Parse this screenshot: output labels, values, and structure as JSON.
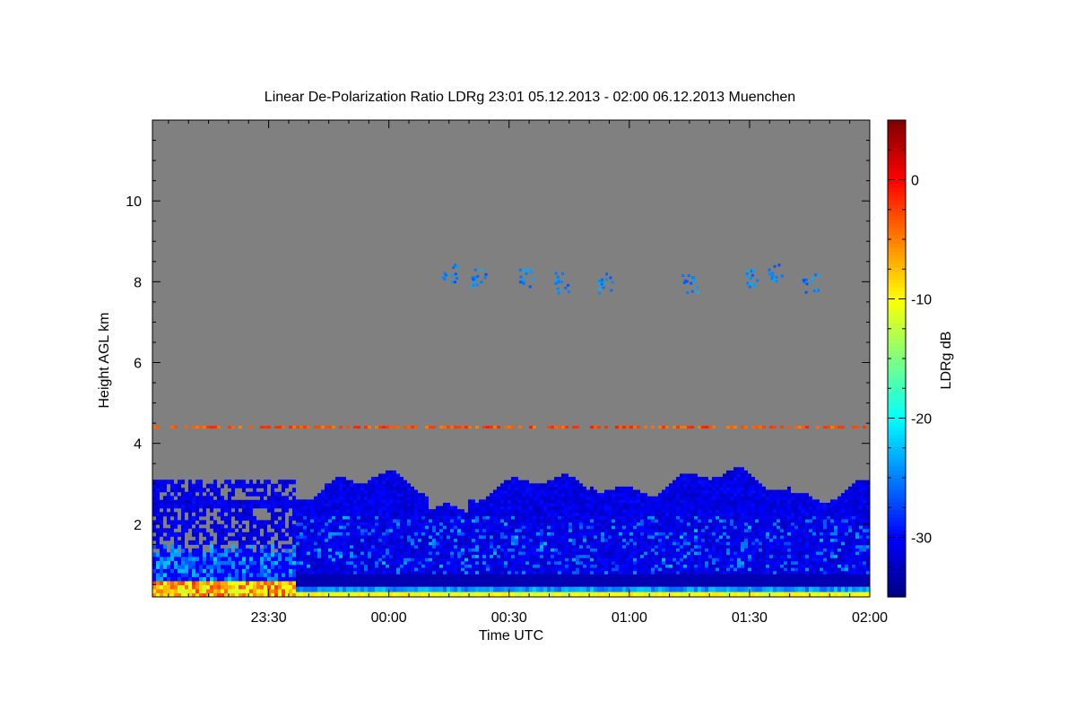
{
  "chart_data": {
    "type": "heatmap",
    "title": "Linear De-Polarization Ratio LDRg   23:01 05.12.2013 - 02:00 06.12.2013 Muenchen",
    "xlabel": "Time UTC",
    "ylabel": "Height AGL km",
    "x_tick_labels": [
      "23:30",
      "00:00",
      "00:30",
      "01:00",
      "01:30",
      "02:00"
    ],
    "x_ticks_minutes": [
      30,
      60,
      90,
      120,
      150,
      180
    ],
    "xlim_minutes": [
      1,
      180
    ],
    "y_tick_labels": [
      "2",
      "4",
      "6",
      "8",
      "10"
    ],
    "y_ticks": [
      2,
      4,
      6,
      8,
      10
    ],
    "ylim": [
      0.2,
      12
    ],
    "colorbar": {
      "label": "LDRg dB",
      "tick_labels": [
        "0",
        "-10",
        "-20",
        "-30"
      ],
      "ticks": [
        0,
        -10,
        -20,
        -30
      ],
      "range": [
        -35,
        5
      ],
      "colors": [
        "#00007f",
        "#0000ff",
        "#007fff",
        "#00ffff",
        "#7fff7f",
        "#ffff00",
        "#ff7f00",
        "#ff0000",
        "#7f0000"
      ]
    },
    "no_signal_color": "#808080",
    "features": {
      "cloud_top_km": 3.1,
      "layer_4_4km_height": 4.4,
      "layer_4_4km_ldr": -3,
      "high_cirrus_height_km": 8.1,
      "high_cirrus_ldr": -25,
      "cloud_body_ldr": -31,
      "cloud_start_minutes": 37,
      "near_surface_ldr": -12
    }
  }
}
